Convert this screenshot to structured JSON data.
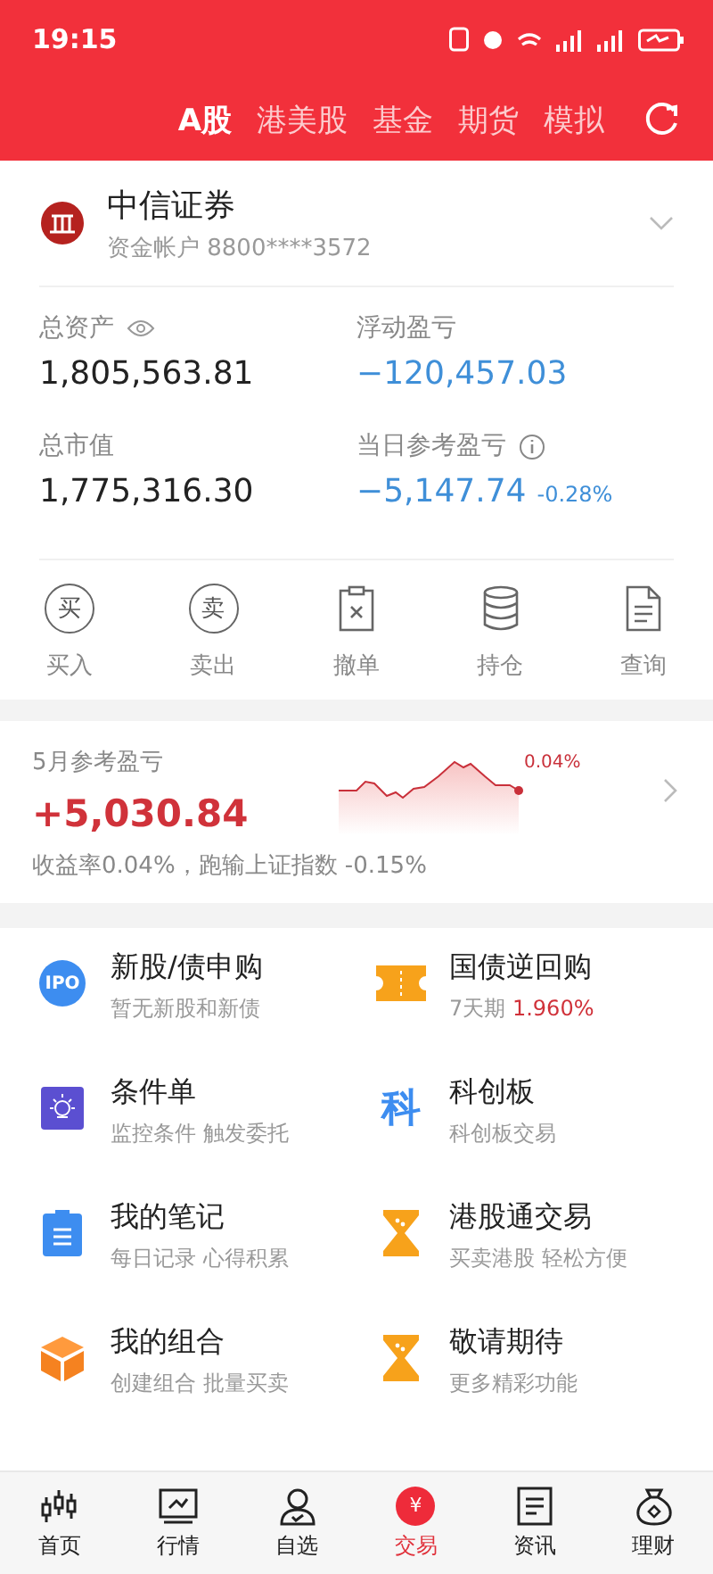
{
  "status_bar": {
    "time": "19:15"
  },
  "tabs": [
    {
      "label": "A股",
      "selected": true
    },
    {
      "label": "港美股",
      "selected": false
    },
    {
      "label": "基金",
      "selected": false
    },
    {
      "label": "期货",
      "selected": false
    },
    {
      "label": "模拟",
      "selected": false
    }
  ],
  "account": {
    "broker": "中信证券",
    "account_label": "资金帐户 8800****3572"
  },
  "assets": [
    {
      "label": "总资产",
      "value": "1,805,563.81",
      "color": "#222222"
    },
    {
      "label": "浮动盈亏",
      "value": "−120,457.03",
      "color": "#3f8fd8"
    },
    {
      "label": "总市值",
      "value": "1,775,316.30",
      "color": "#222222"
    },
    {
      "label": "当日参考盈亏",
      "value": "−5,147.74",
      "change": "-0.28%",
      "color": "#3f8fd8"
    }
  ],
  "actions": [
    {
      "label": "买入",
      "badge": "买"
    },
    {
      "label": "卖出",
      "badge": "卖"
    },
    {
      "label": "撤单"
    },
    {
      "label": "持仓"
    },
    {
      "label": "查询"
    }
  ],
  "monthly": {
    "title": "5月参考盈亏",
    "value": "+5,030.84",
    "chart_label": "0.04%",
    "summary": "收益率0.04%，跑输上证指数 -0.15%"
  },
  "services": [
    {
      "title": "新股/债申购",
      "subtitle": "暂无新股和新债",
      "badge": "IPO"
    },
    {
      "title": "国债逆回购",
      "subtitle": "7天期",
      "rate": "1.960%"
    },
    {
      "title": "条件单",
      "subtitle": "监控条件 触发委托"
    },
    {
      "title": "科创板",
      "subtitle": "科创板交易",
      "badge": "科"
    },
    {
      "title": "我的笔记",
      "subtitle": "每日记录 心得积累"
    },
    {
      "title": "港股通交易",
      "subtitle": "买卖港股 轻松方便"
    },
    {
      "title": "我的组合",
      "subtitle": "创建组合 批量买卖"
    },
    {
      "title": "敬请期待",
      "subtitle": "更多精彩功能"
    }
  ],
  "bottom_nav": [
    {
      "label": "首页",
      "selected": false
    },
    {
      "label": "行情",
      "selected": false
    },
    {
      "label": "自选",
      "selected": false
    },
    {
      "label": "交易",
      "selected": true,
      "badge": "¥"
    },
    {
      "label": "资讯",
      "selected": false
    },
    {
      "label": "理财",
      "selected": false
    }
  ]
}
